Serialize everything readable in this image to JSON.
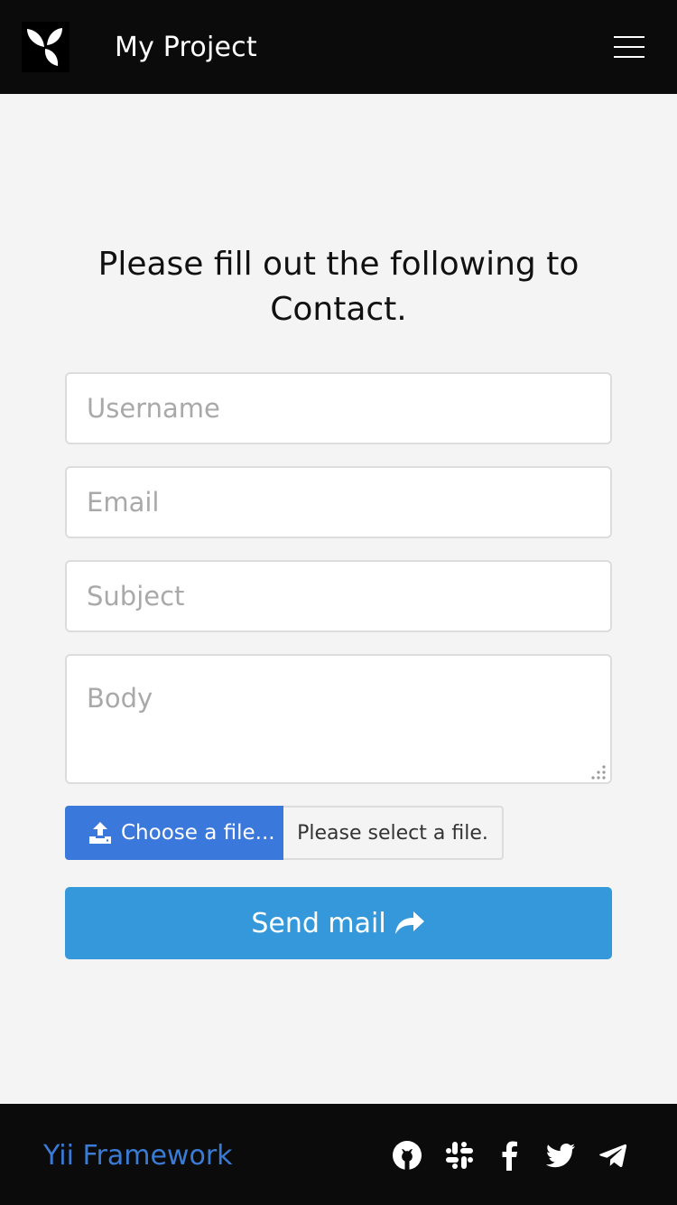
{
  "navbar": {
    "brand": "My Project",
    "logo_icon": "yii-logo-icon",
    "menu_icon": "hamburger-menu-icon"
  },
  "contact": {
    "heading": "Please fill out the following to Contact.",
    "username_placeholder": "Username",
    "email_placeholder": "Email",
    "subject_placeholder": "Subject",
    "body_placeholder": "Body",
    "file_button_label": "Choose a file...",
    "file_status": "Please select a file.",
    "submit_label": "Send mail"
  },
  "footer": {
    "link": "Yii Framework",
    "social_icons": [
      "github-icon",
      "slack-icon",
      "facebook-icon",
      "twitter-icon",
      "telegram-icon"
    ]
  },
  "colors": {
    "navbar_bg": "#0b0b0b",
    "page_bg": "#f4f4f4",
    "file_button": "#3a78db",
    "submit_button": "#3498db",
    "footer_link": "#3a7bd5"
  }
}
